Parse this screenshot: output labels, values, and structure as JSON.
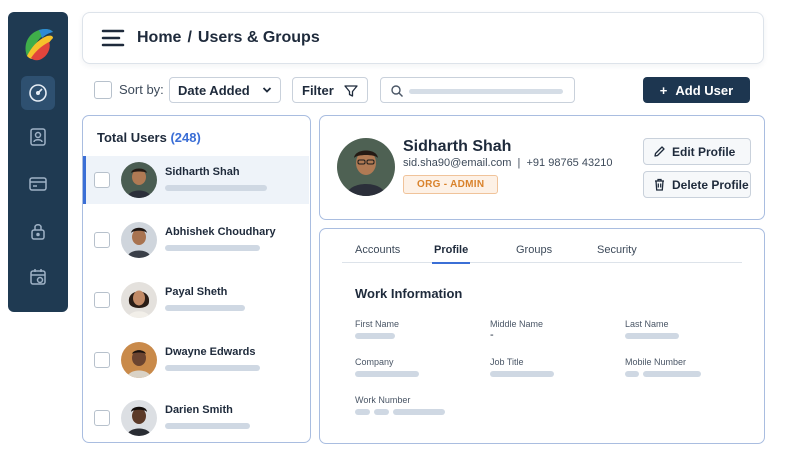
{
  "header": {
    "breadcrumb": {
      "home": "Home",
      "separator": "/",
      "current": "Users & Groups"
    }
  },
  "sidebar": {
    "items": [
      {
        "icon": "dashboard-icon",
        "active": true
      },
      {
        "icon": "user-card-icon",
        "active": false
      },
      {
        "icon": "credit-card-icon",
        "active": false
      },
      {
        "icon": "lock-icon",
        "active": false
      },
      {
        "icon": "calendar-icon",
        "active": false
      }
    ]
  },
  "toolbar": {
    "sort_label": "Sort by:",
    "sort_value": "Date Added",
    "filter_label": "Filter",
    "add_user_icon": "+",
    "add_user_label": "Add User"
  },
  "users": {
    "title": "Total Users",
    "count": "(248)",
    "list": [
      {
        "name": "Sidharth Shah",
        "selected": true
      },
      {
        "name": "Abhishek Choudhary",
        "selected": false
      },
      {
        "name": "Payal Sheth",
        "selected": false
      },
      {
        "name": "Dwayne Edwards",
        "selected": false
      },
      {
        "name": "Darien Smith",
        "selected": false
      }
    ]
  },
  "profile": {
    "name": "Sidharth Shah",
    "email": "sid.sha90@email.com",
    "separator": "|",
    "phone": "+91 98765 43210",
    "role": "ORG - ADMIN",
    "edit_label": "Edit Profile",
    "delete_label": "Delete Profile"
  },
  "details": {
    "tabs": [
      "Accounts",
      "Profile",
      "Groups",
      "Security"
    ],
    "active_tab": "Profile",
    "section_title": "Work Information",
    "fields": {
      "first_name": "First Name",
      "middle_name": "Middle Name",
      "middle_name_value": "-",
      "last_name": "Last Name",
      "company": "Company",
      "job_title": "Job Title",
      "mobile_number": "Mobile Number",
      "work_number": "Work Number"
    }
  },
  "colors": {
    "sidebar": "#1f3a52",
    "primary_button": "#1d3650",
    "accent": "#3b6fd6",
    "badge_text": "#d9822b"
  }
}
